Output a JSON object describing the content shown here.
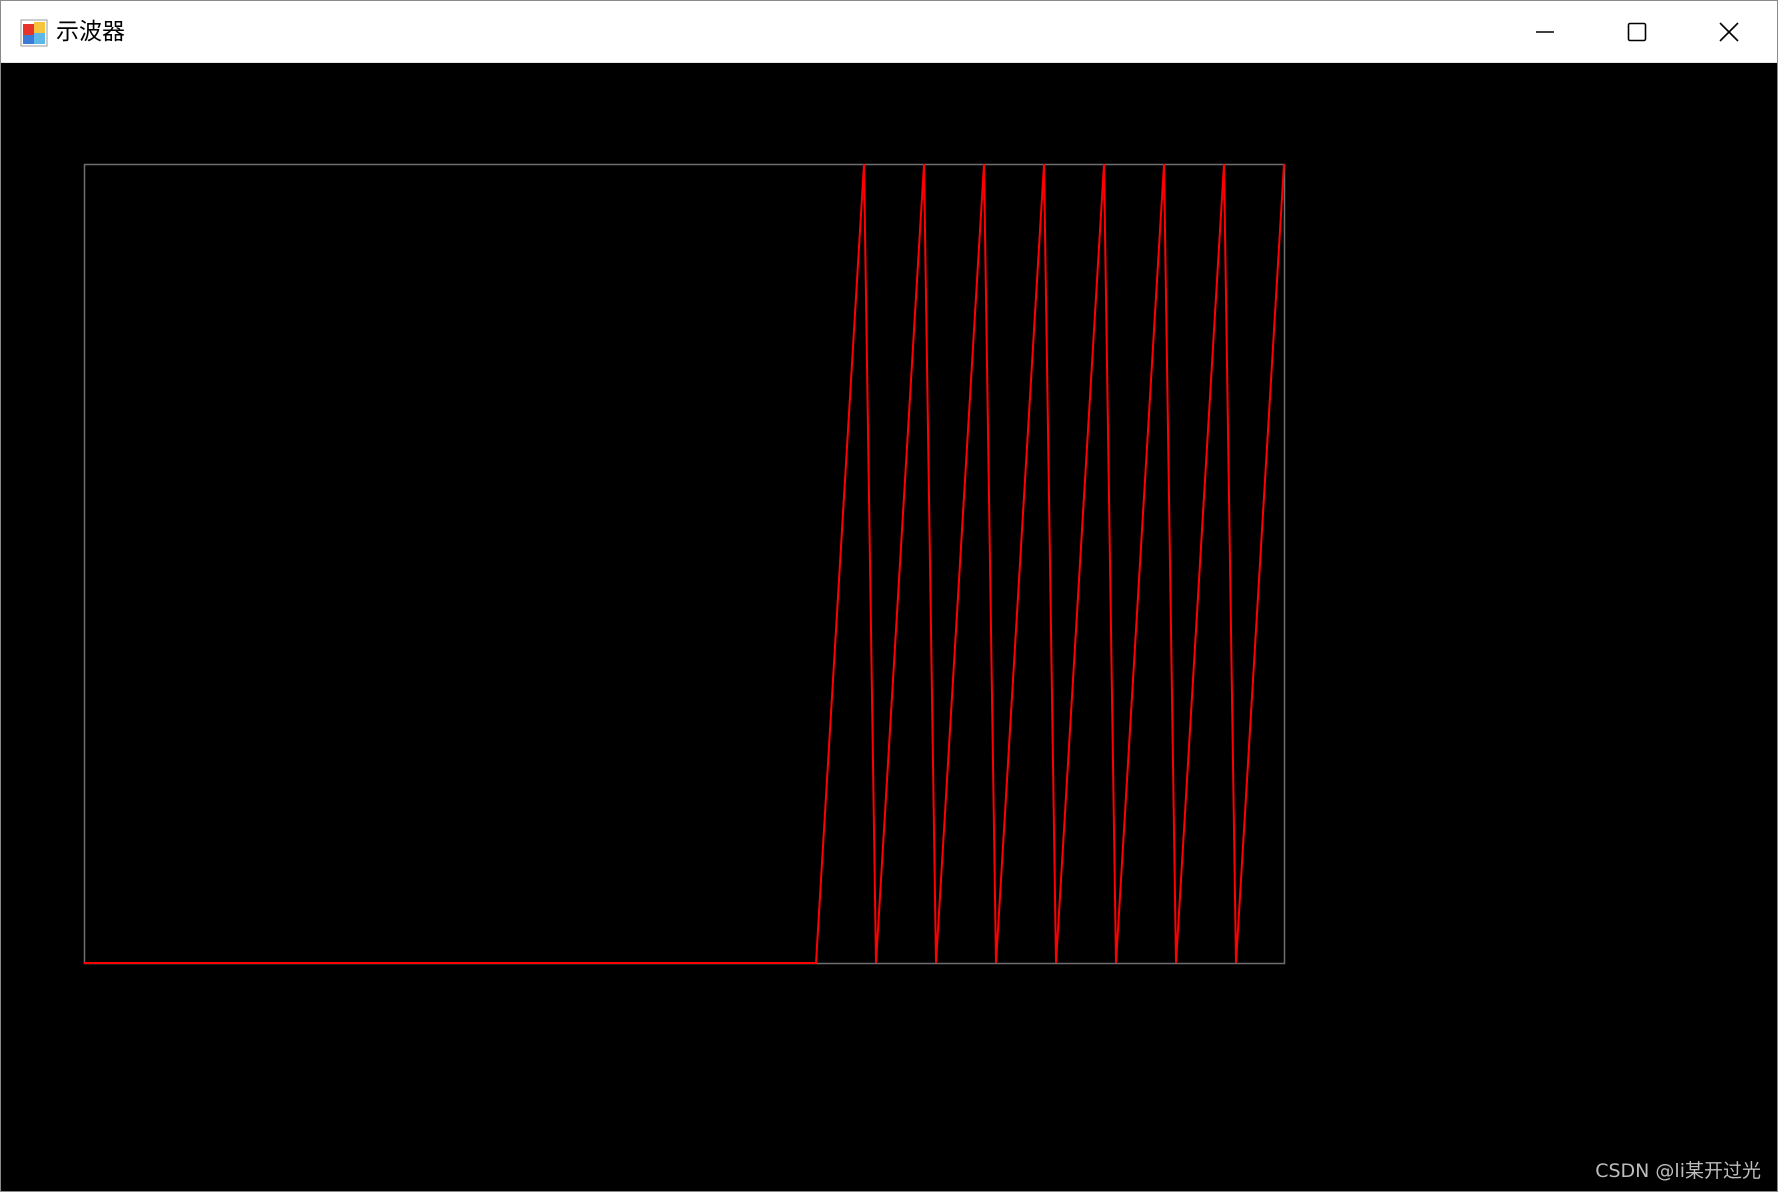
{
  "window": {
    "title": "示波器",
    "icon": "app-window-icon",
    "controls": {
      "minimize_icon": "minimize-icon",
      "maximize_icon": "maximize-icon",
      "close_icon": "close-icon"
    }
  },
  "colors": {
    "background": "#000000",
    "frame": "#6e6e6e",
    "trace": "#ff0000"
  },
  "chart_data": {
    "type": "line",
    "title": "",
    "xlabel": "",
    "ylabel": "",
    "grid": false,
    "legend": "none",
    "xlim": [
      0,
      1200
    ],
    "ylim": [
      0,
      255
    ],
    "series": [
      {
        "name": "",
        "x": [
          0,
          732,
          780,
          792,
          840,
          852,
          900,
          912,
          960,
          972,
          1020,
          1032,
          1080,
          1092,
          1140,
          1152,
          1200
        ],
        "values": [
          0,
          0,
          255,
          0,
          255,
          0,
          255,
          0,
          255,
          0,
          255,
          0,
          255,
          0,
          255,
          0,
          255
        ]
      }
    ]
  },
  "watermark": "CSDN @li某开过光"
}
